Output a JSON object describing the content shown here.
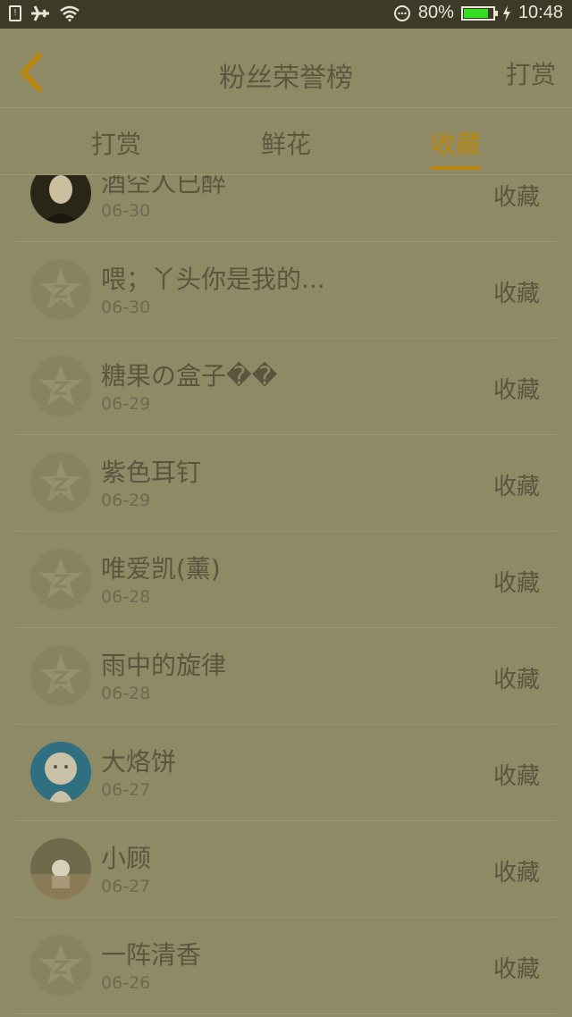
{
  "status_bar": {
    "battery": "80%",
    "time": "10:48",
    "icons": [
      "sim-icon",
      "airplane-icon",
      "wifi-icon",
      "chat-icon",
      "battery-icon",
      "charging-icon"
    ]
  },
  "header": {
    "title": "粉丝荣誉榜",
    "action": "打赏"
  },
  "tabs": [
    {
      "label": "打赏"
    },
    {
      "label": "鲜花"
    },
    {
      "label": "收藏",
      "active": true
    }
  ],
  "list": [
    {
      "name": "酒空人已醉",
      "date": "06-30",
      "action": "收藏"
    },
    {
      "name": "喂；丫头你是我的...",
      "date": "06-30",
      "action": "收藏"
    },
    {
      "name": "糖果の盒子��",
      "date": "06-29",
      "action": "收藏"
    },
    {
      "name": "紫色耳钉",
      "date": "06-29",
      "action": "收藏"
    },
    {
      "name": "唯爱凯(薰)",
      "date": "06-28",
      "action": "收藏"
    },
    {
      "name": "雨中的旋律",
      "date": "06-28",
      "action": "收藏"
    },
    {
      "name": "大烙饼",
      "date": "06-27",
      "action": "收藏"
    },
    {
      "name": "小顾",
      "date": "06-27",
      "action": "收藏"
    },
    {
      "name": "一阵清香",
      "date": "06-26",
      "action": "收藏"
    }
  ],
  "colors": {
    "background": "#8f8a66",
    "accent": "#b8860b",
    "status_bar": "#3d3b27"
  }
}
